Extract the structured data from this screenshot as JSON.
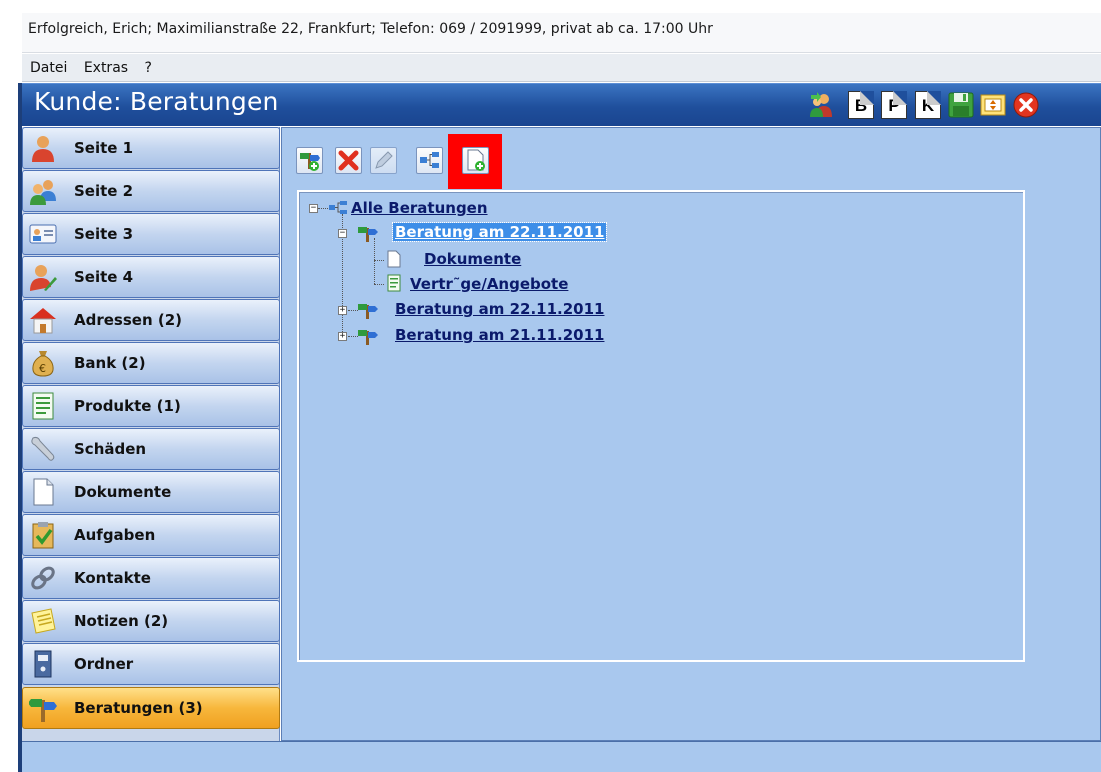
{
  "window": {
    "title": "Erfolgreich, Erich; Maximilianstraße 22, Frankfurt; Telefon: 069 / 2091999, privat ab ca. 17:00 Uhr"
  },
  "menu": {
    "items": [
      "Datei",
      "Extras",
      "?"
    ]
  },
  "header": {
    "title": "Kunde: Beratungen",
    "buttons": {
      "b": "B",
      "p": "P",
      "k": "K"
    }
  },
  "sidebar": {
    "items": [
      {
        "label": "Seite 1",
        "icon": "person-icon"
      },
      {
        "label": "Seite 2",
        "icon": "people-icon"
      },
      {
        "label": "Seite 3",
        "icon": "id-card-icon"
      },
      {
        "label": "Seite 4",
        "icon": "person-edit-icon"
      },
      {
        "label": "Adressen (2)",
        "icon": "house-icon"
      },
      {
        "label": "Bank (2)",
        "icon": "money-bag-icon"
      },
      {
        "label": "Produkte (1)",
        "icon": "contract-icon"
      },
      {
        "label": "Schäden",
        "icon": "wrench-icon"
      },
      {
        "label": "Dokumente",
        "icon": "document-icon"
      },
      {
        "label": "Aufgaben",
        "icon": "clipboard-check-icon"
      },
      {
        "label": "Kontakte",
        "icon": "link-icon"
      },
      {
        "label": "Notizen (2)",
        "icon": "notes-icon"
      },
      {
        "label": "Ordner",
        "icon": "binder-icon"
      },
      {
        "label": "Beratungen (3)",
        "icon": "signpost-icon",
        "active": true
      }
    ]
  },
  "tree": {
    "root": "Alle Beratungen",
    "nodes": [
      {
        "label": "Beratung am 22.11.2011",
        "expanded": true,
        "selected": true,
        "children": [
          "Dokumente",
          "Vertr˜ge/Angebote"
        ]
      },
      {
        "label": "Beratung am 22.11.2011",
        "expanded": false
      },
      {
        "label": "Beratung am 21.11.2011",
        "expanded": false
      }
    ]
  },
  "colors": {
    "header": "#1f4f9c",
    "main_bg": "#a9c8ee",
    "selection": "#3d8ee8",
    "active_nav": "#f7b73c",
    "highlight": "#ff0000"
  }
}
